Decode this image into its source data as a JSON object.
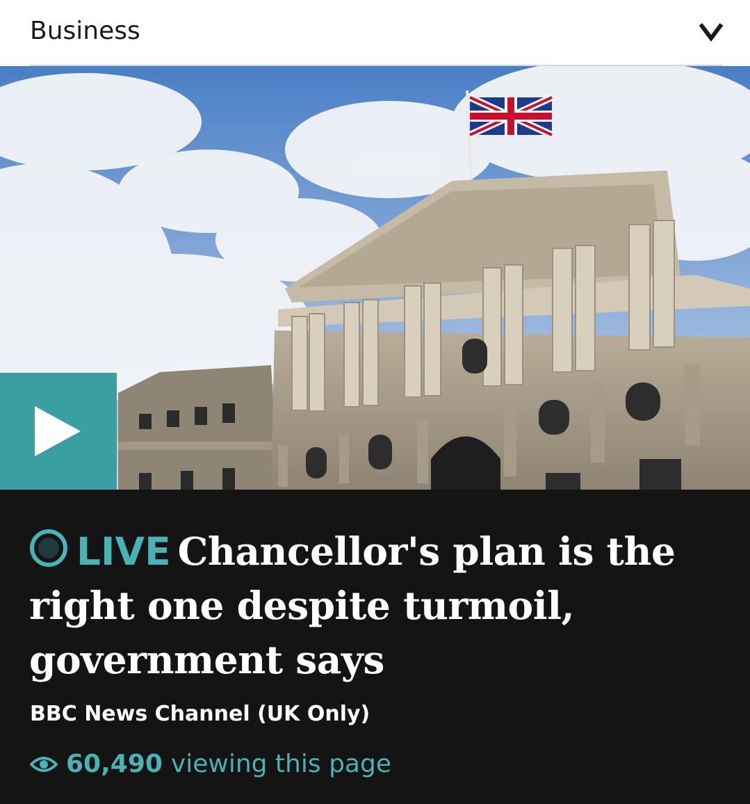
{
  "section": {
    "title": "Business",
    "toggle_icon": "chevron-down-icon"
  },
  "media": {
    "play_icon": "play-icon",
    "accent_color": "#3a9fa3"
  },
  "story": {
    "live_icon": "live-indicator-icon",
    "live_label": "LIVE",
    "headline": "Chancellor's plan is the right one despite turmoil, government says",
    "channel": "BBC News Channel (UK Only)",
    "viewer_icon": "eye-icon",
    "viewer_count": "60,490",
    "viewer_suffix": "viewing this page"
  },
  "colors": {
    "panel_background": "#141414",
    "live_color": "#4ab1b4"
  }
}
